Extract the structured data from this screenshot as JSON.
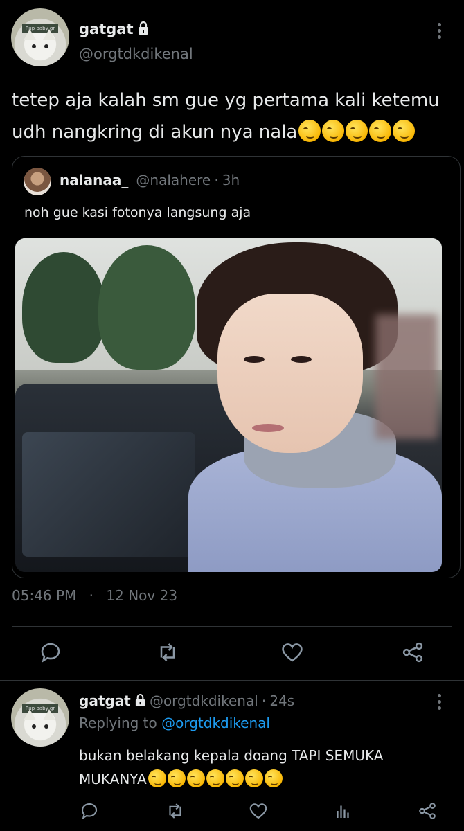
{
  "main_tweet": {
    "display_name": "gatgat",
    "handle": "@orgtdkdikenal",
    "avatar_tag": "Rup baby gr",
    "text": "tetep aja kalah sm gue yg pertama kali ketemu udh nangkring di akun nya nala",
    "emoji_count": 5,
    "timestamp": "05:46 PM",
    "separator": "·",
    "date": "12 Nov 23"
  },
  "quoted_tweet": {
    "display_name": "nalanaa_",
    "handle": "@nalahere",
    "separator": "·",
    "age": "3h",
    "text": "noh gue kasi fotonya langsung aja"
  },
  "reply_tweet": {
    "display_name": "gatgat",
    "handle": "@orgtdkdikenal",
    "separator": "·",
    "age": "24s",
    "replying_label": "Replying to",
    "replying_handle": "@orgtdkdikenal",
    "text": "bukan belakang kepala doang TAPI SEMUKA MUKANYA",
    "emoji_count": 7,
    "avatar_tag": "Rup baby gr"
  },
  "icons": {
    "reply": "reply-icon",
    "retweet": "retweet-icon",
    "like": "heart-icon",
    "views": "analytics-icon",
    "share": "share-icon",
    "more": "more-vertical-icon",
    "lock": "lock-icon"
  },
  "colors": {
    "background": "#000000",
    "text": "#e7e9ea",
    "muted": "#71767b",
    "link": "#1d9bf0",
    "border": "#2f3336"
  }
}
